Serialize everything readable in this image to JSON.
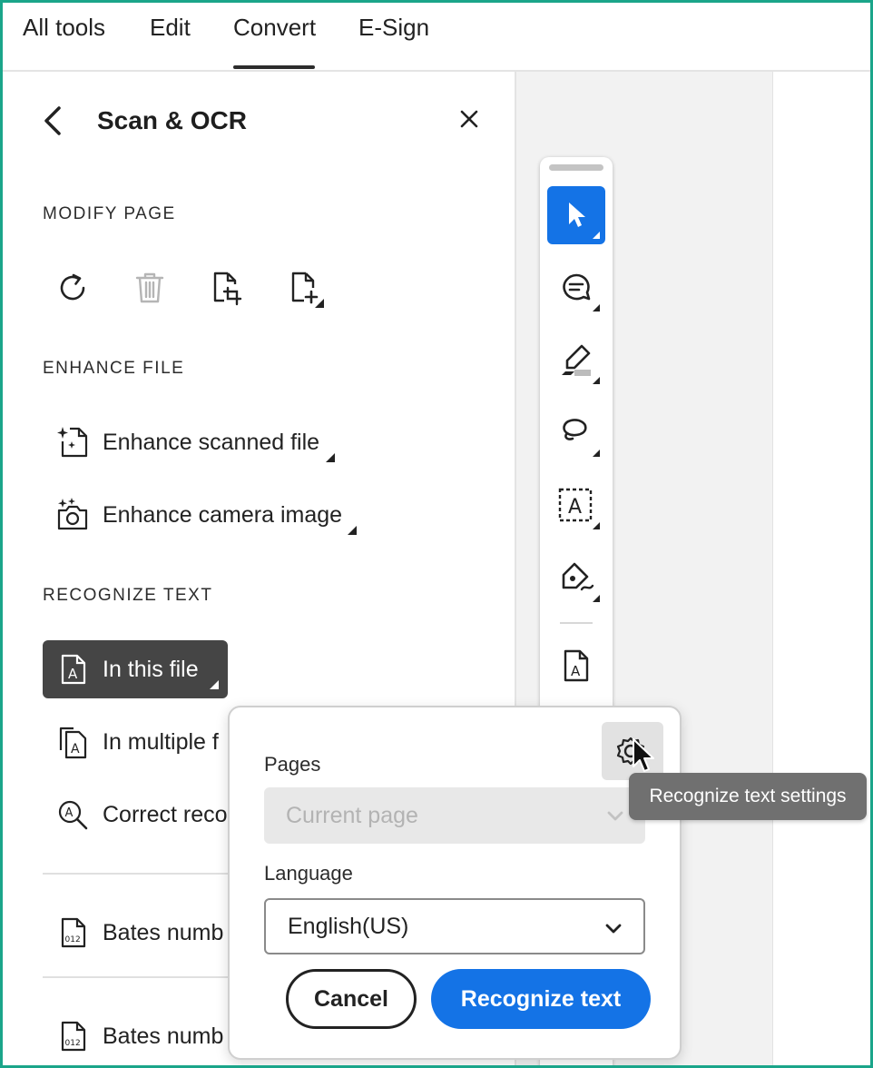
{
  "tabs": [
    "All tools",
    "Edit",
    "Convert",
    "E-Sign"
  ],
  "active_tab": "Convert",
  "panel": {
    "title": "Scan & OCR",
    "sections": {
      "modify_page": "MODIFY PAGE",
      "enhance_file": "ENHANCE FILE",
      "recognize_text": "RECOGNIZE TEXT"
    },
    "modify_icons": [
      "rotate-icon",
      "trash-icon",
      "crop-page-icon",
      "add-page-icon"
    ],
    "enhance_items": [
      {
        "label": "Enhance scanned file",
        "icon": "enhance-scan-icon"
      },
      {
        "label": "Enhance camera image",
        "icon": "enhance-camera-icon"
      }
    ],
    "recognize_items": [
      {
        "label": "In this file",
        "icon": "ocr-file-icon",
        "selected": true
      },
      {
        "label": "In multiple f",
        "icon": "ocr-multiple-icon"
      },
      {
        "label": "Correct reco",
        "icon": "correct-text-icon"
      }
    ],
    "bates_items": [
      {
        "label": "Bates numb",
        "icon": "bates-icon"
      },
      {
        "label": "Bates numb",
        "icon": "bates-icon"
      }
    ]
  },
  "toolbar_icons": [
    "select-arrow-icon",
    "comment-icon",
    "highlighter-icon",
    "lasso-icon",
    "text-recognition-icon",
    "signature-pen-icon",
    "ocr-doc-icon"
  ],
  "popup": {
    "pages_label": "Pages",
    "pages_value": "Current page",
    "language_label": "Language",
    "language_value": "English(US)",
    "cancel_label": "Cancel",
    "recognize_label": "Recognize text"
  },
  "tooltip": "Recognize text settings",
  "colors": {
    "accent": "#1473e6",
    "selected_bg": "#454545",
    "frame": "#1aa58a"
  }
}
